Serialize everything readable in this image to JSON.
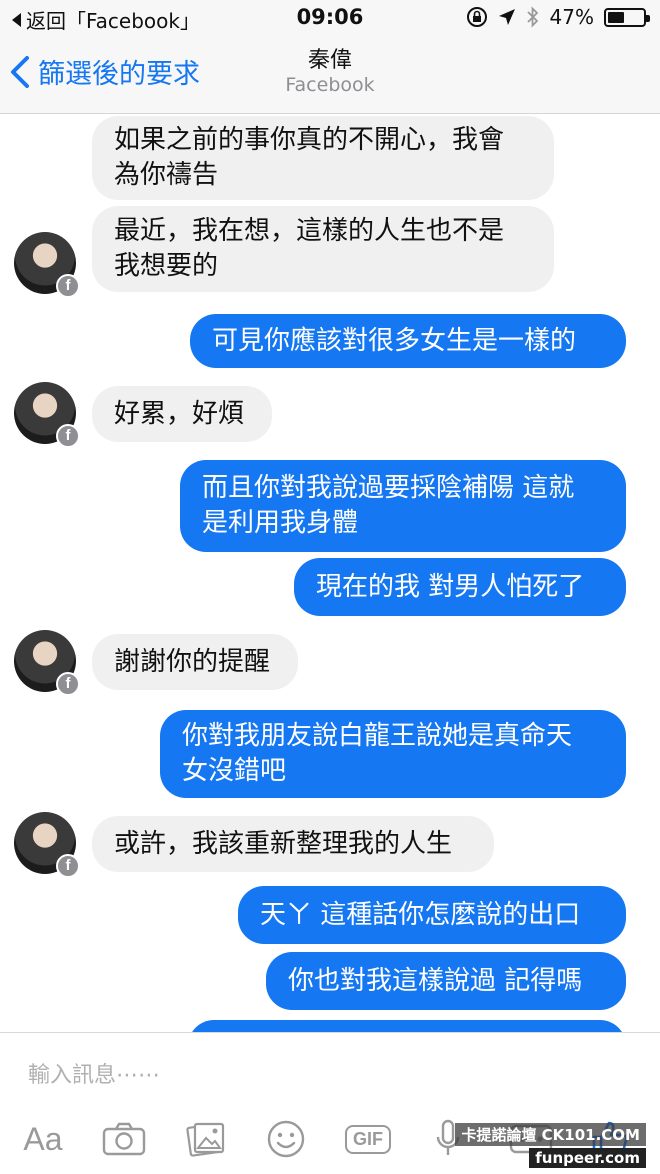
{
  "status_bar": {
    "back_app": "返回「Facebook」",
    "time": "09:06",
    "battery": "47%",
    "battery_level": 0.47
  },
  "nav": {
    "back_label": "篩選後的要求",
    "title": "秦偉",
    "subtitle": "Facebook"
  },
  "messages": [
    {
      "side": "in",
      "lines": [
        "如果之前的事你真的不開心，我會",
        "為你禱告"
      ]
    },
    {
      "side": "in",
      "lines": [
        "最近，我在想，這樣的人生也不是",
        "我想要的"
      ]
    },
    {
      "side": "out",
      "lines": [
        "可見你應該對很多女生是一樣的"
      ]
    },
    {
      "side": "in",
      "lines": [
        "好累，好煩"
      ]
    },
    {
      "side": "out",
      "lines": [
        "而且你對我說過要採陰補陽 這就",
        "是利用我身體"
      ]
    },
    {
      "side": "out",
      "lines": [
        "現在的我 對男人怕死了"
      ]
    },
    {
      "side": "in",
      "lines": [
        "謝謝你的提醒"
      ]
    },
    {
      "side": "out",
      "lines": [
        "你對我朋友說白龍王說她是真命天",
        "女沒錯吧"
      ]
    },
    {
      "side": "in",
      "lines": [
        "或許，我該重新整理我的人生"
      ]
    },
    {
      "side": "out",
      "lines": [
        "天ㄚ 這種話你怎麼說的出口"
      ]
    },
    {
      "side": "out",
      "lines": [
        "你也對我這樣說過 記得嗎"
      ]
    }
  ],
  "avatar_badge": "f",
  "composer": {
    "placeholder": "輸入訊息⋯⋯",
    "tools": {
      "text": "Aa",
      "gif": "GIF"
    }
  },
  "watermark": {
    "line1": "卡提諾論壇 CK101.COM",
    "line2": "funpeer.com"
  },
  "colors": {
    "accent": "#1677f2",
    "incoming_bubble": "#f0f0f0",
    "bar_bg": "#f7f7f7"
  }
}
